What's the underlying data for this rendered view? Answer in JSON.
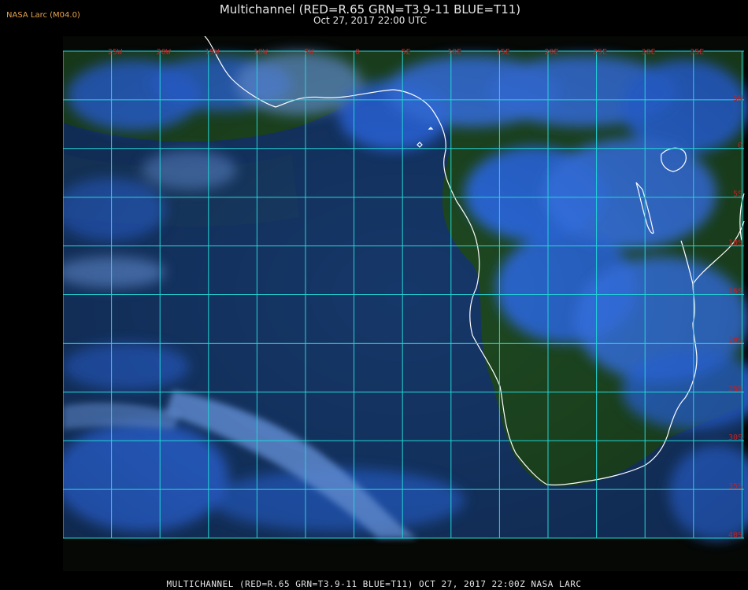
{
  "corner_tag": "NASA Larc (M04.0)",
  "title": "Multichannel (RED=R.65 GRN=T3.9-11 BLUE=T11)",
  "subtitle": "Oct 27, 2017 22:00 UTC",
  "footer": "MULTICHANNEL (RED=R.65 GRN=T3.9-11 BLUE=T11) OCT 27, 2017 22:00Z   NASA LARC",
  "lon_labels": [
    "25W",
    "20W",
    "15W",
    "10W",
    "5W",
    "0",
    "5E",
    "10E",
    "15E",
    "20E",
    "25E",
    "30E",
    "35E"
  ],
  "lat_labels": [
    "5N",
    "0",
    "5S",
    "10S",
    "15S",
    "20S",
    "25S",
    "30S",
    "35S",
    "40S"
  ],
  "colors": {
    "ocean": "#16386a",
    "land": "#1f4a22",
    "cloud": "#2f6ff0",
    "cloud_light": "#6fa2f2",
    "grid": "#22d6d6",
    "coast": "#ffffff",
    "label": "#c42020",
    "tag": "#e8a24a"
  }
}
